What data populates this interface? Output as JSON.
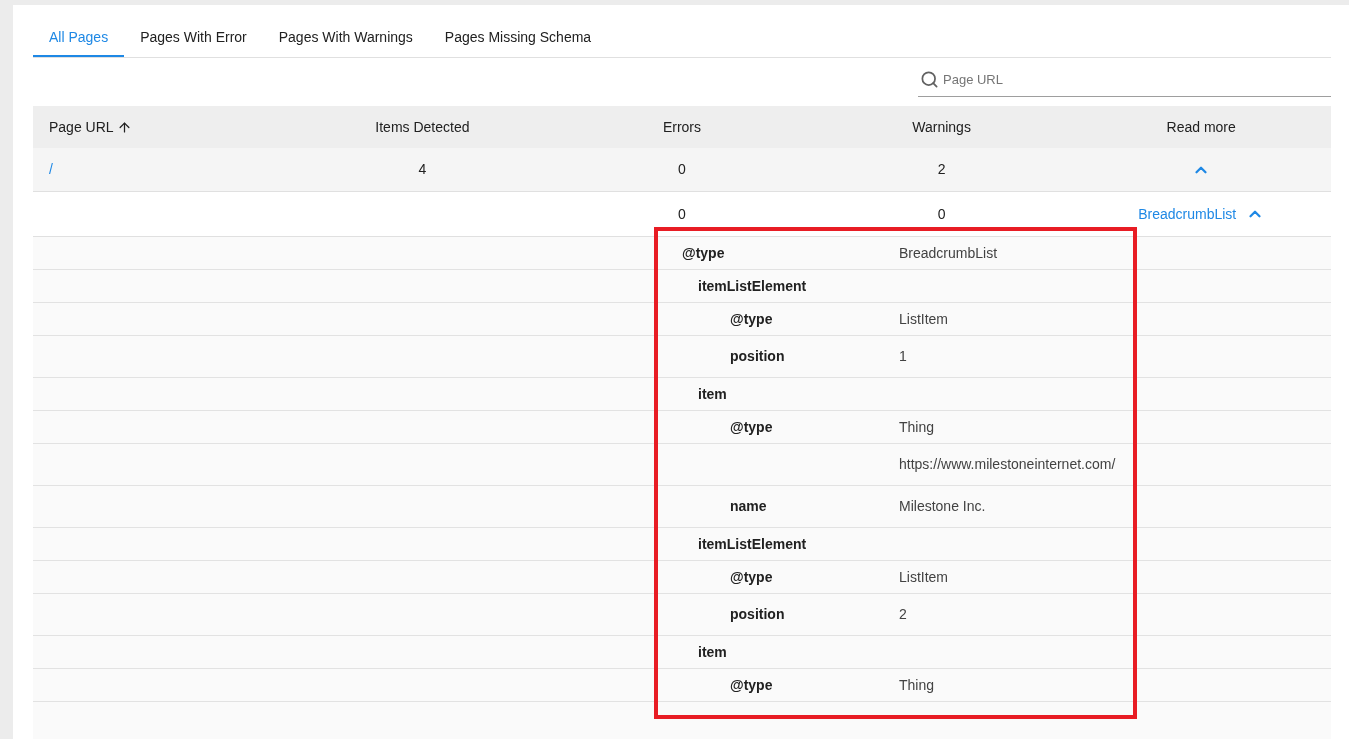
{
  "tabs": [
    {
      "label": "All Pages",
      "selected": true
    },
    {
      "label": "Pages With Error",
      "selected": false
    },
    {
      "label": "Pages With Warnings",
      "selected": false
    },
    {
      "label": "Pages Missing Schema",
      "selected": false
    }
  ],
  "search": {
    "placeholder": "Page URL"
  },
  "table": {
    "columns": [
      {
        "label": "Page URL",
        "sort_ascending": true
      },
      {
        "label": "Items Detected"
      },
      {
        "label": "Errors"
      },
      {
        "label": "Warnings"
      },
      {
        "label": "Read more"
      }
    ],
    "rows": [
      {
        "page_url": "/",
        "items_detected": "4",
        "errors": "0",
        "warnings": "2",
        "expanded": true,
        "schemas": [
          {
            "errors": "0",
            "warnings": "0",
            "type": "BreadcrumbList",
            "expanded": true,
            "properties": [
              {
                "key": "@type",
                "value": "BreadcrumbList",
                "children": [
                  {
                    "key": "itemListElement",
                    "children": [
                      {
                        "key": "@type",
                        "value": "ListItem"
                      },
                      {
                        "key": "position",
                        "value": "1"
                      }
                    ]
                  },
                  {
                    "key": "item",
                    "children": [
                      {
                        "key": "@type",
                        "value": "Thing"
                      },
                      {
                        "value": "https://www.milestoneinternet.com/"
                      },
                      {
                        "key": "name",
                        "value": "Milestone Inc."
                      }
                    ]
                  },
                  {
                    "key": "itemListElement",
                    "children": [
                      {
                        "key": "@type",
                        "value": "ListItem"
                      },
                      {
                        "key": "position",
                        "value": "2"
                      }
                    ]
                  },
                  {
                    "key": "item",
                    "children": [
                      {
                        "key": "@type",
                        "value": "Thing"
                      }
                    ]
                  }
                ]
              }
            ]
          }
        ]
      }
    ]
  }
}
